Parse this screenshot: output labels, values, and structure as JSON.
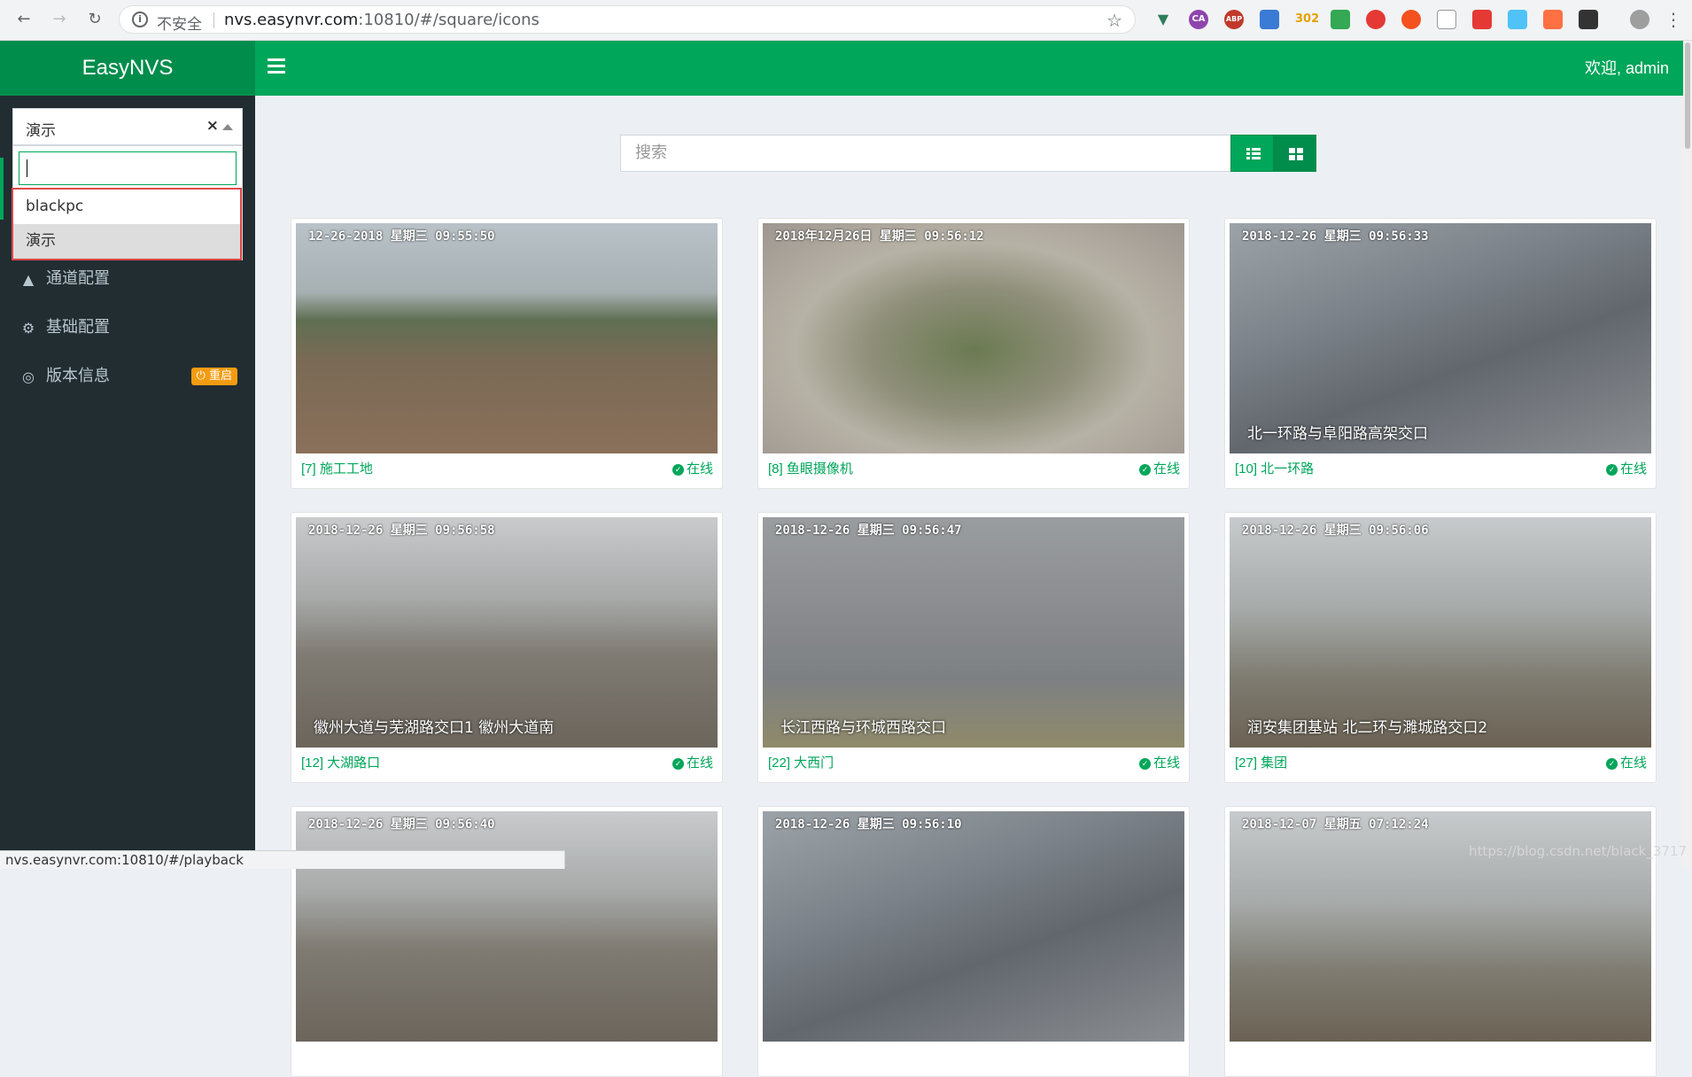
{
  "browser": {
    "insecure_label": "不安全",
    "url_host": "nvs.easynvr.com",
    "url_rest": ":10810/#/square/icons",
    "ext_badge_302": "302",
    "ext_badge_abp": "ABP",
    "ext_badge_ca": "CA",
    "status_url": "nvs.easynvr.com:10810/#/playback"
  },
  "header": {
    "brand": "EasyNVS",
    "welcome": "欢迎, admin"
  },
  "select": {
    "current": "演示",
    "clear": "×",
    "options": [
      {
        "label": "blackpc"
      },
      {
        "label": "演示"
      }
    ]
  },
  "sidebar": {
    "items": [
      {
        "label": "通道配置",
        "icon": "road-icon"
      },
      {
        "label": "基础配置",
        "icon": "cogs-icon"
      },
      {
        "label": "版本信息",
        "icon": "support-icon"
      }
    ],
    "restart_badge": "⏻ 重启"
  },
  "search": {
    "placeholder": "搜索"
  },
  "cards": [
    {
      "title": "[7] 施工工地",
      "status": "在线",
      "timestamp": "12-26-2018  星期三  09:55:50",
      "caption": "",
      "theme": "construction"
    },
    {
      "title": "[8] 鱼眼摄像机",
      "status": "在线",
      "timestamp": "2018年12月26日 星期三 09:56:12",
      "caption": "",
      "theme": "fisheye"
    },
    {
      "title": "[10] 北一环路",
      "status": "在线",
      "timestamp": "2018-12-26  星期三  09:56:33",
      "caption": "北一环路与阜阳路高架交口",
      "theme": "road"
    },
    {
      "title": "[12] 大湖路口",
      "status": "在线",
      "timestamp": "2018-12-26  星期三  09:56:58",
      "caption": "徽州大道与芜湖路交口1      徽州大道南",
      "theme": "city"
    },
    {
      "title": "[22] 大西门",
      "status": "在线",
      "timestamp": "2018-12-26  星期三  09:56:47",
      "caption": "长江西路与环城西路交口",
      "theme": "crossing"
    },
    {
      "title": "[27] 集团",
      "status": "在线",
      "timestamp": "2018-12-26  星期三  09:56:06",
      "caption": "润安集团基站      北二环与濉城路交口2",
      "theme": "fog"
    },
    {
      "title": "",
      "status": "",
      "timestamp": "2018-12-26  星期三  09:56:40",
      "caption": "",
      "theme": "city"
    },
    {
      "title": "",
      "status": "",
      "timestamp": "2018-12-26  星期三  09:56:10",
      "caption": "",
      "theme": "road"
    },
    {
      "title": "",
      "status": "",
      "timestamp": "2018-12-07  星期五  07:12:24",
      "caption": "",
      "theme": "fog"
    }
  ],
  "watermark": "https://blog.csdn.net/black_3717"
}
